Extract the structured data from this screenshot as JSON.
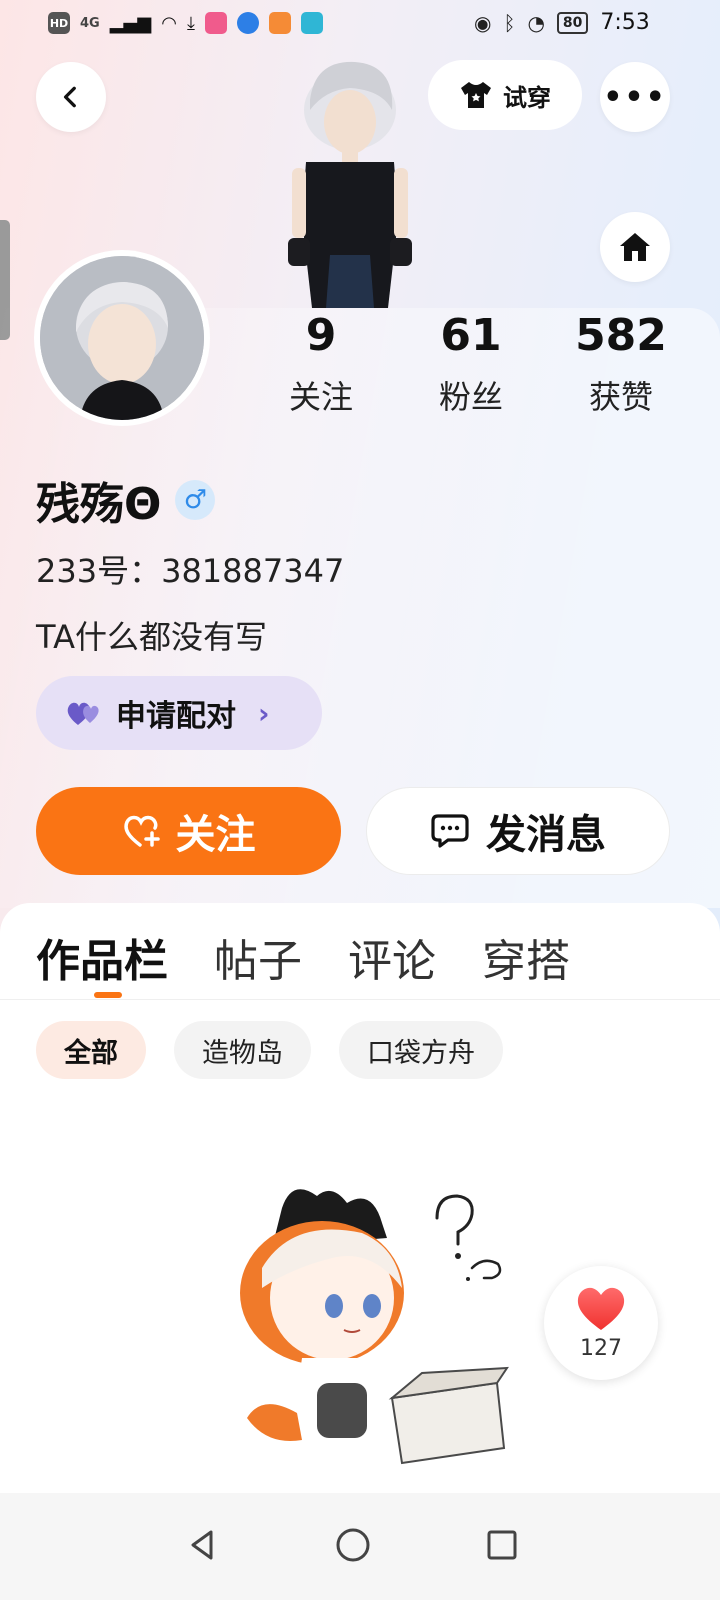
{
  "status_bar": {
    "time": "7:53",
    "battery": "80",
    "left_indicators": [
      "HD",
      "4G"
    ],
    "icons": [
      "signal-icon",
      "wifi-icon",
      "download-icon",
      "app-icon",
      "app-icon",
      "app-icon",
      "app-icon",
      "eye-icon",
      "bluetooth-icon",
      "speed-icon"
    ]
  },
  "header": {
    "try_on_label": "试穿"
  },
  "profile": {
    "stats": [
      {
        "value": "9",
        "label": "关注"
      },
      {
        "value": "61",
        "label": "粉丝"
      },
      {
        "value": "582",
        "label": "获赞"
      }
    ],
    "username": "残殇Θ",
    "gender_symbol": "♂",
    "id_text": "233号：381887347",
    "bio": "TA什么都没有写",
    "pair_button_label": "申请配对"
  },
  "actions": {
    "follow_label": "关注",
    "message_label": "发消息"
  },
  "tabs": [
    "作品栏",
    "帖子",
    "评论",
    "穿搭"
  ],
  "filters": [
    "全部",
    "造物岛",
    "口袋方舟"
  ],
  "like_count": "127",
  "colors": {
    "accent": "#fa7414",
    "pair_bg": "#e6e0f6",
    "gender": "#2f8be9"
  }
}
